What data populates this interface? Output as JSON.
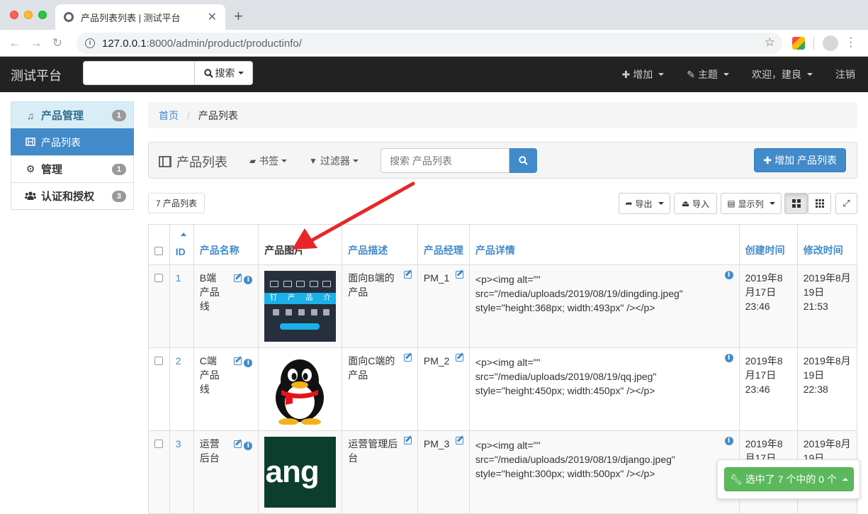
{
  "browser": {
    "tab_title": "产品列表列表 | 测试平台",
    "url_host": "127.0.0.1",
    "url_path": ":8000/admin/product/productinfo/"
  },
  "navbar": {
    "brand": "测试平台",
    "search_button": "搜索",
    "add": "增加",
    "theme": "主题",
    "welcome": "欢迎，建良",
    "logout": "注销"
  },
  "sidebar": {
    "items": [
      {
        "label": "产品管理",
        "badge": "1",
        "icon": "music-icon"
      },
      {
        "label": "产品列表",
        "icon": "film-icon"
      },
      {
        "label": "管理",
        "badge": "1",
        "icon": "gear-icon"
      },
      {
        "label": "认证和授权",
        "badge": "3",
        "icon": "users-icon"
      }
    ]
  },
  "breadcrumb": {
    "home": "首页",
    "current": "产品列表"
  },
  "panel": {
    "title": "产品列表",
    "bookmarks": "书签",
    "filters": "过滤器",
    "search_placeholder": "搜索 产品列表",
    "add_button": "增加 产品列表"
  },
  "toolbar": {
    "count": "7 产品列表",
    "export": "导出",
    "import": "导入",
    "columns": "显示列"
  },
  "table": {
    "headers": [
      "ID",
      "产品名称",
      "产品图片",
      "产品描述",
      "产品经理",
      "产品详情",
      "创建时间",
      "修改时间"
    ],
    "rows": [
      {
        "id": "1",
        "name": "B端产品线",
        "image": "dingding",
        "desc": "面向B端的产品",
        "pm": "PM_1",
        "detail": "<p><img alt=\"\" src=\"/media/uploads/2019/08/19/dingding.jpeg\" style=\"height:368px; width:493px\" /></p>",
        "created": "2019年8月17日 23:46",
        "modified": "2019年8月19日 21:53"
      },
      {
        "id": "2",
        "name": "C端产品线",
        "image": "qq",
        "desc": "面向C端的产品",
        "pm": "PM_2",
        "detail": "<p><img alt=\"\" src=\"/media/uploads/2019/08/19/qq.jpeg\" style=\"height:450px; width:450px\" /></p>",
        "created": "2019年8月17日 23:46",
        "modified": "2019年8月19日 22:38"
      },
      {
        "id": "3",
        "name": "运营后台",
        "image": "django",
        "desc": "运营管理后台",
        "pm": "PM_3",
        "detail": "<p><img alt=\"\" src=\"/media/uploads/2019/08/19/django.jpeg\" style=\"height:300px; width:500px\" /></p>",
        "created": "2019年8月17日 23:47",
        "modified": "2019年8月19日 22:40"
      }
    ]
  },
  "images": {
    "dingding_band": [
      "钉",
      "产",
      "品",
      "介"
    ],
    "django_text": "jang"
  },
  "action": {
    "selected": "选中了 7 个中的 0 个"
  },
  "colors": {
    "primary": "#428bca",
    "success": "#5cb85c",
    "navbar": "#222222",
    "arrow": "#e8262a"
  }
}
